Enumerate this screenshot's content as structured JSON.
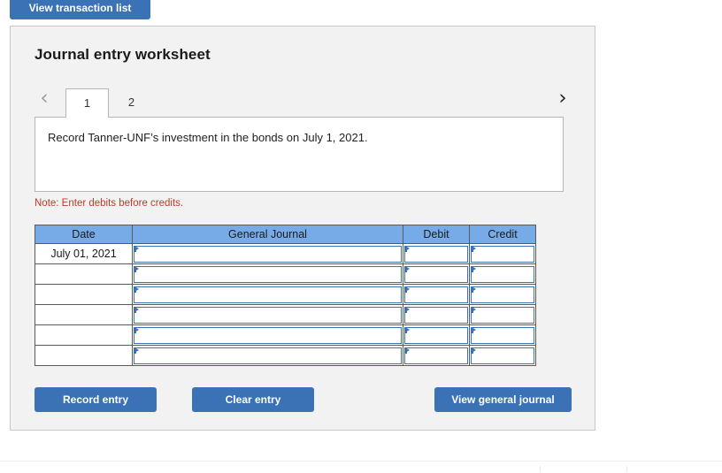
{
  "top_bar": {
    "view_transaction_list_label": "View transaction list"
  },
  "worksheet": {
    "title": "Journal entry worksheet",
    "nav": {
      "prev_icon": "chevron-left-icon",
      "next_icon": "chevron-right-icon",
      "prev_glyph": "‹",
      "next_glyph": "›"
    },
    "tabs": [
      {
        "label": "1",
        "active": true
      },
      {
        "label": "2",
        "active": false
      }
    ],
    "description": "Record Tanner-UNF’s investment in the bonds on July 1, 2021.",
    "note": "Note: Enter debits before credits."
  },
  "journal_table": {
    "columns": [
      "Date",
      "General Journal",
      "Debit",
      "Credit"
    ],
    "rows": [
      {
        "date": "July 01, 2021",
        "general_journal": "",
        "debit": "",
        "credit": ""
      },
      {
        "date": "",
        "general_journal": "",
        "debit": "",
        "credit": ""
      },
      {
        "date": "",
        "general_journal": "",
        "debit": "",
        "credit": ""
      },
      {
        "date": "",
        "general_journal": "",
        "debit": "",
        "credit": ""
      },
      {
        "date": "",
        "general_journal": "",
        "debit": "",
        "credit": ""
      },
      {
        "date": "",
        "general_journal": "",
        "debit": "",
        "credit": ""
      }
    ]
  },
  "actions": {
    "record_entry_label": "Record entry",
    "clear_entry_label": "Clear entry",
    "view_general_journal_label": "View general journal"
  },
  "colors": {
    "button_blue": "#3A72B5",
    "header_blue": "#76ABE8",
    "note_red": "#c0392b",
    "card_bg": "#f2f2f2",
    "card_border": "#c8c8c8"
  }
}
